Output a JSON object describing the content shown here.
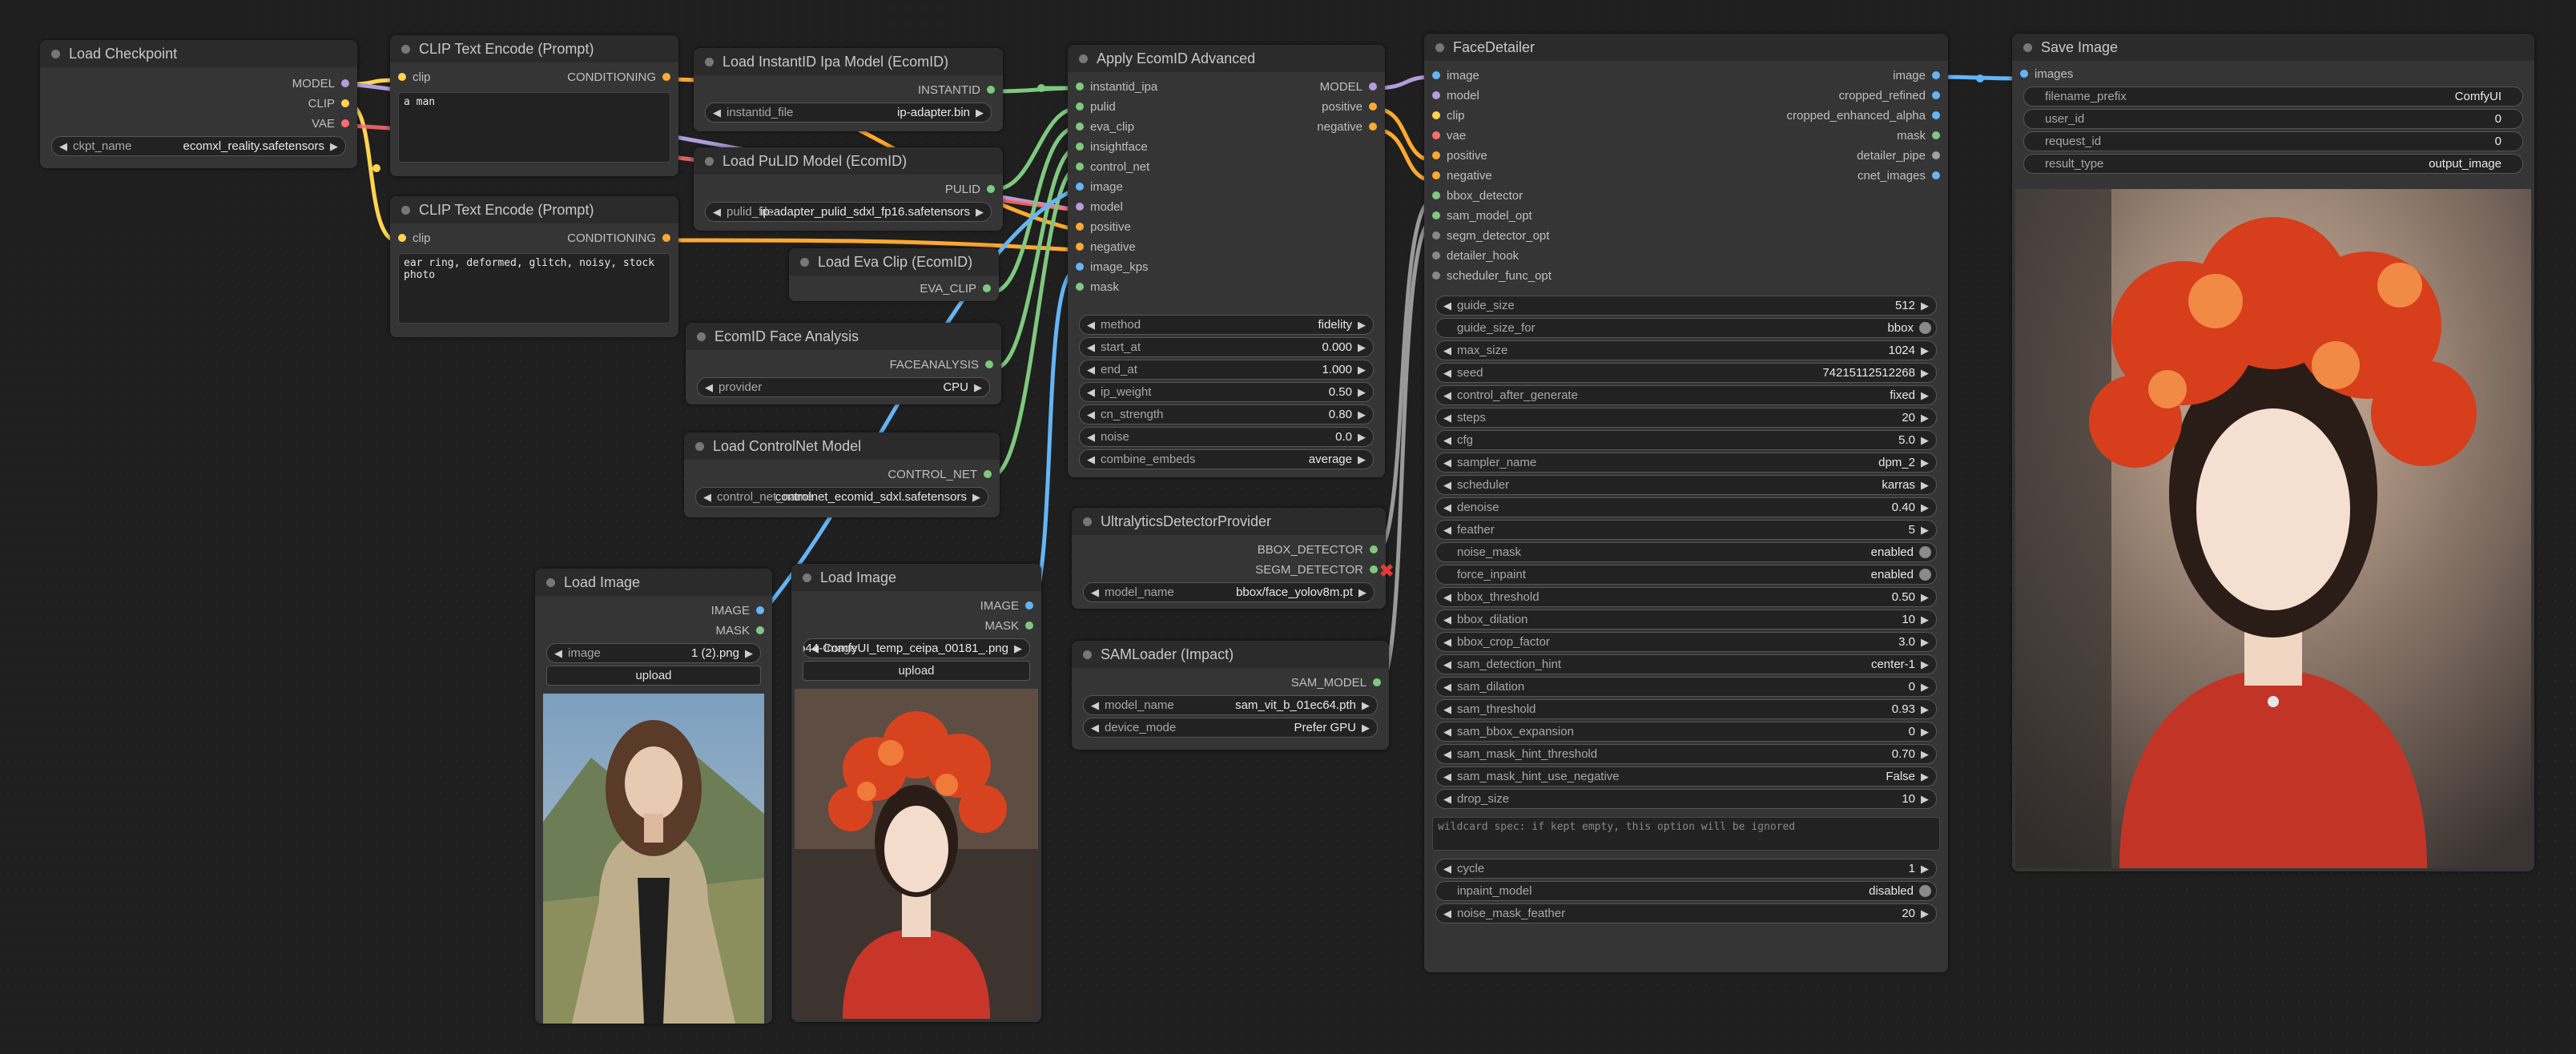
{
  "colors": {
    "model": "#b39ddb",
    "clip": "#ffd54f",
    "vae": "#ff6e6e",
    "conditioning": "#ffa931",
    "image": "#64b5f6",
    "mask": "#81c784",
    "generic": "#7fc87f",
    "pipe": "#a0a0a0"
  },
  "nodes": {
    "load_checkpoint": {
      "title": "Load Checkpoint",
      "outputs": [
        "MODEL",
        "CLIP",
        "VAE"
      ],
      "widget": {
        "label": "ckpt_name",
        "value": "ecomxl_reality.safetensors"
      }
    },
    "clip_text_1": {
      "title": "CLIP Text Encode (Prompt)",
      "input": "clip",
      "output": "CONDITIONING",
      "text": "a man"
    },
    "clip_text_2": {
      "title": "CLIP Text Encode (Prompt)",
      "input": "clip",
      "output": "CONDITIONING",
      "text": "ear ring, deformed, glitch, noisy, stock\nphoto"
    },
    "instantid": {
      "title": "Load InstantID Ipa Model (EcomID)",
      "output": "INSTANTID",
      "widget": {
        "label": "instantid_file",
        "value": "ip-adapter.bin"
      }
    },
    "pulid": {
      "title": "Load PuLID Model (EcomID)",
      "output": "PULID",
      "widget": {
        "label": "pulid_file",
        "value": "ip-adapter_pulid_sdxl_fp16.safetensors"
      }
    },
    "eva_clip": {
      "title": "Load Eva Clip (EcomID)",
      "output": "EVA_CLIP"
    },
    "face_analysis": {
      "title": "EcomID Face Analysis",
      "output": "FACEANALYSIS",
      "widget": {
        "label": "provider",
        "value": "CPU"
      }
    },
    "controlnet": {
      "title": "Load ControlNet Model",
      "output": "CONTROL_NET",
      "widget": {
        "label": "control_net_name",
        "value": "controlnet_ecomid_sdxl.safetensors"
      }
    },
    "load_image_1": {
      "title": "Load Image",
      "outputs": [
        "IMAGE",
        "MASK"
      ],
      "widget": {
        "label": "image",
        "value": "1 (2).png"
      },
      "upload": "upload"
    },
    "load_image_2": {
      "title": "Load Image",
      "outputs": [
        "IMAGE",
        "MASK"
      ],
      "widget": {
        "label": "image",
        "value": "2b44-ComfyUI_temp_ceipa_00181_.png"
      },
      "upload": "upload"
    },
    "apply": {
      "title": "Apply EcomID Advanced",
      "inputs": [
        "instantid_ipa",
        "pulid",
        "eva_clip",
        "insightface",
        "control_net",
        "image",
        "model",
        "positive",
        "negative",
        "image_kps",
        "mask"
      ],
      "outputs": [
        "MODEL",
        "positive",
        "negative"
      ],
      "widgets": [
        {
          "label": "method",
          "value": "fidelity"
        },
        {
          "label": "start_at",
          "value": "0.000"
        },
        {
          "label": "end_at",
          "value": "1.000"
        },
        {
          "label": "ip_weight",
          "value": "0.50"
        },
        {
          "label": "cn_strength",
          "value": "0.80"
        },
        {
          "label": "noise",
          "value": "0.0"
        },
        {
          "label": "combine_embeds",
          "value": "average"
        }
      ]
    },
    "ultra": {
      "title": "UltralyticsDetectorProvider",
      "outputs": [
        "BBOX_DETECTOR",
        "SEGM_DETECTOR"
      ],
      "widget": {
        "label": "model_name",
        "value": "bbox/face_yolov8m.pt"
      }
    },
    "sam": {
      "title": "SAMLoader (Impact)",
      "output": "SAM_MODEL",
      "widgets": [
        {
          "label": "model_name",
          "value": "sam_vit_b_01ec64.pth"
        },
        {
          "label": "device_mode",
          "value": "Prefer GPU"
        }
      ]
    },
    "facedetailer": {
      "title": "FaceDetailer",
      "inputs": [
        "image",
        "model",
        "clip",
        "vae",
        "positive",
        "negative",
        "bbox_detector",
        "sam_model_opt",
        "segm_detector_opt",
        "detailer_hook",
        "scheduler_func_opt"
      ],
      "outputs": [
        "image",
        "cropped_refined",
        "cropped_enhanced_alpha",
        "mask",
        "detailer_pipe",
        "cnet_images"
      ],
      "widgets": [
        {
          "label": "guide_size",
          "value": "512"
        },
        {
          "label": "guide_size_for",
          "value": "bbox",
          "toggle": true
        },
        {
          "label": "max_size",
          "value": "1024"
        },
        {
          "label": "seed",
          "value": "742151125122​68"
        },
        {
          "label": "control_after_generate",
          "value": "fixed"
        },
        {
          "label": "steps",
          "value": "20"
        },
        {
          "label": "cfg",
          "value": "5.0"
        },
        {
          "label": "sampler_name",
          "value": "dpm_2"
        },
        {
          "label": "scheduler",
          "value": "karras"
        },
        {
          "label": "denoise",
          "value": "0.40"
        },
        {
          "label": "feather",
          "value": "5"
        },
        {
          "label": "noise_mask",
          "value": "enabled",
          "toggle": true
        },
        {
          "label": "force_inpaint",
          "value": "enabled",
          "toggle": true
        },
        {
          "label": "bbox_threshold",
          "value": "0.50"
        },
        {
          "label": "bbox_dilation",
          "value": "10"
        },
        {
          "label": "bbox_crop_factor",
          "value": "3.0"
        },
        {
          "label": "sam_detection_hint",
          "value": "center-1"
        },
        {
          "label": "sam_dilation",
          "value": "0"
        },
        {
          "label": "sam_threshold",
          "value": "0.93"
        },
        {
          "label": "sam_bbox_expansion",
          "value": "0"
        },
        {
          "label": "sam_mask_hint_threshold",
          "value": "0.70"
        },
        {
          "label": "sam_mask_hint_use_negative",
          "value": "False"
        },
        {
          "label": "drop_size",
          "value": "10"
        }
      ],
      "wildcard": "wildcard spec: if kept empty, this option will be ignored",
      "widgets2": [
        {
          "label": "cycle",
          "value": "1"
        },
        {
          "label": "inpaint_model",
          "value": "disabled",
          "toggle": true
        },
        {
          "label": "noise_mask_feather",
          "value": "20"
        }
      ]
    },
    "save": {
      "title": "Save Image",
      "input": "images",
      "widgets": [
        {
          "label": "filename_prefix",
          "value": "ComfyUI"
        },
        {
          "label": "user_id",
          "value": "0"
        },
        {
          "label": "request_id",
          "value": "0"
        },
        {
          "label": "result_type",
          "value": "output_image"
        }
      ]
    }
  }
}
